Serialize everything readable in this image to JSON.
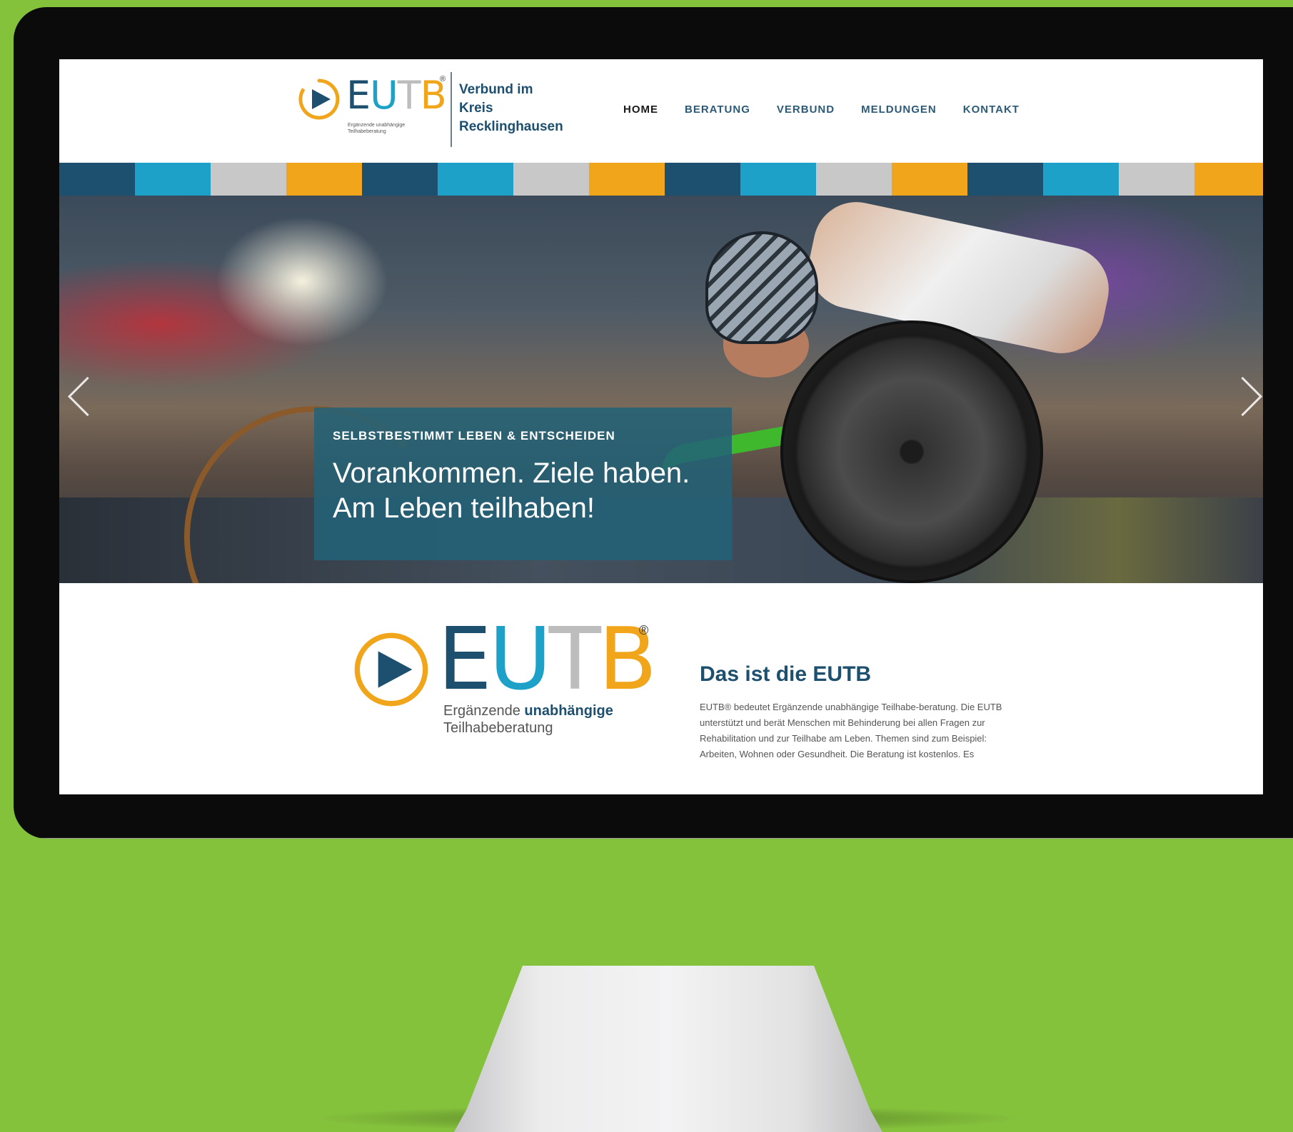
{
  "header": {
    "logo": {
      "word": [
        "E",
        "U",
        "T",
        "B"
      ],
      "word_colors": [
        "#1d4f6e",
        "#1ea1c9",
        "#bdbdbd",
        "#f0a51b"
      ],
      "registered": "®",
      "subtitle_line1": "Ergänzende unabhängige",
      "subtitle_line2": "Teilhabeberatung"
    },
    "brand_text": "Verbund im\nKreis\nRecklinghausen",
    "nav": [
      {
        "label": "HOME",
        "active": true
      },
      {
        "label": "BERATUNG",
        "active": false
      },
      {
        "label": "VERBUND",
        "active": false
      },
      {
        "label": "MELDUNGEN",
        "active": false
      },
      {
        "label": "KONTAKT",
        "active": false
      }
    ]
  },
  "stripe_colors": [
    "#1d4f6e",
    "#1ea1c9",
    "#c8c8c8",
    "#f0a51b"
  ],
  "hero": {
    "kicker": "SELBSTBESTIMMT LEBEN & ENTSCHEIDEN",
    "headline_line1": "Vorankommen. Ziele haben.",
    "headline_line2": "Am Leben teilhaben!",
    "prev_icon": "chevron-left-icon",
    "next_icon": "chevron-right-icon"
  },
  "about": {
    "title": "Das ist die EUTB",
    "text": "EUTB® bedeutet Ergänzende unabhängige Teilhabe-beratung. Die EUTB unterstützt und berät Menschen mit Behinderung bei allen Fragen zur Rehabilitation und zur Teilhabe am Leben. Themen sind zum Beispiel: Arbeiten, Wohnen oder Gesundheit. Die Beratung ist kostenlos. Es"
  },
  "big_logo": {
    "subtitle_prefix": "Ergänzende ",
    "subtitle_bold": "unabhängige",
    "subtitle_line2": "Teilhabeberatung"
  }
}
